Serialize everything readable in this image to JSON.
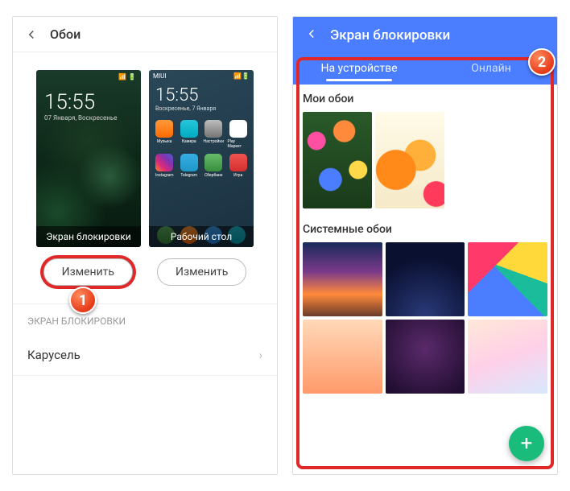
{
  "left": {
    "title": "Обои",
    "lock_time": "15:55",
    "lock_date": "07 Января, Воскресенье",
    "lock_label": "Экран блокировки",
    "home_time": "15:55",
    "home_date": "Воскресенье, 7 Января",
    "home_label": "Рабочий стол",
    "home_icons": [
      "Музыка",
      "Камера",
      "Настройки",
      "Play Маркет",
      "Instagram",
      "Telegram",
      "Сбербанк",
      "Игра"
    ],
    "change_btn_1": "Изменить",
    "change_btn_2": "Изменить",
    "section": "ЭКРАН БЛОКИРОВКИ",
    "carousel": "Карусель"
  },
  "right": {
    "title": "Экран блокировки",
    "tab_device": "На устройстве",
    "tab_online": "Онлайн",
    "my_wallpapers": "Мои обои",
    "system_wallpapers": "Системные обои"
  },
  "callouts": {
    "one": "1",
    "two": "2"
  }
}
